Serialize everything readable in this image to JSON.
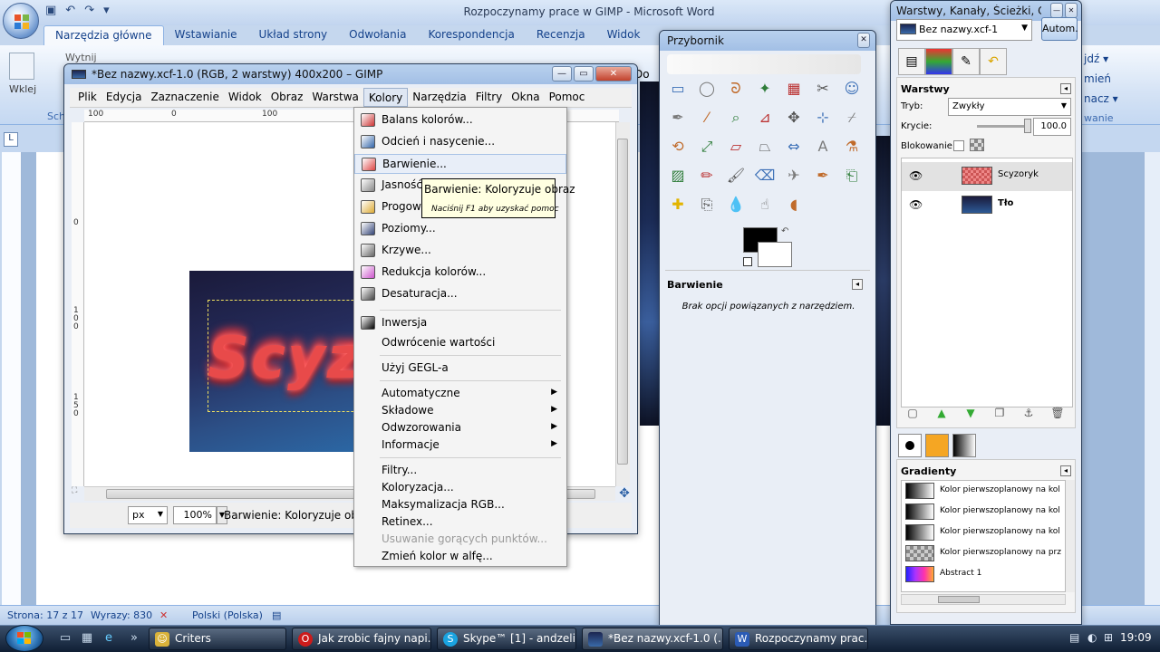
{
  "word": {
    "title": "Rozpoczynamy prace w GIMP - Microsoft Word",
    "tabs": [
      "Narzędzia główne",
      "Wstawianie",
      "Układ strony",
      "Odwołania",
      "Korespondencja",
      "Recenzja",
      "Widok",
      "Dewe"
    ],
    "paste": "Wklej",
    "cut": "Wytnij",
    "clipboard": "Sch",
    "right_ribbon": [
      "jdź ▾",
      "mień",
      "nacz ▾",
      "wanie"
    ],
    "ruler_left": "L",
    "doc_glimpse": "Do",
    "status": {
      "page": "Strona: 17 z 17",
      "words": "Wyrazy: 830",
      "lang": "Polski (Polska)"
    }
  },
  "gimp": {
    "title": "*Bez nazwy.xcf-1.0 (RGB, 2 warstwy) 400x200 – GIMP",
    "menus": [
      "Plik",
      "Edycja",
      "Zaznaczenie",
      "Widok",
      "Obraz",
      "Warstwa",
      "Kolory",
      "Narzędzia",
      "Filtry",
      "Okna",
      "Pomoc"
    ],
    "hruler": [
      "100",
      "0",
      "100"
    ],
    "vruler": [
      "0",
      "1\n0\n0",
      "1\n5\n0"
    ],
    "image_text": "Scyz",
    "unit": "px",
    "zoom": "100%",
    "status": "Barwienie: Koloryzuje obraz"
  },
  "colors_menu": {
    "items": [
      {
        "label": "Balans kolorów...",
        "icon": "balance-icon"
      },
      {
        "label": "Odcień i nasycenie...",
        "icon": "hue-icon"
      },
      {
        "label": "Barwienie...",
        "icon": "colorize-icon",
        "highlight": true
      },
      {
        "label": "Jasność i kontrast...",
        "icon": "brightness-icon"
      },
      {
        "label": "Progowanie...",
        "icon": "threshold-icon"
      },
      {
        "label": "Poziomy...",
        "icon": "levels-icon"
      },
      {
        "label": "Krzywe...",
        "icon": "curves-icon"
      },
      {
        "label": "Redukcja kolorów...",
        "icon": "posterize-icon"
      },
      {
        "label": "Desaturacja...",
        "icon": "desaturate-icon"
      },
      {
        "label": "Inwersja",
        "icon": "invert-icon"
      },
      {
        "label": "Odwrócenie wartości"
      },
      {
        "label": "Użyj GEGL-a"
      },
      {
        "label": "Automatyczne",
        "submenu": true
      },
      {
        "label": "Składowe",
        "submenu": true
      },
      {
        "label": "Odwzorowania",
        "submenu": true
      },
      {
        "label": "Informacje",
        "submenu": true
      },
      {
        "label": "Filtry..."
      },
      {
        "label": "Koloryzacja..."
      },
      {
        "label": "Maksymalizacja RGB..."
      },
      {
        "label": "Retinex..."
      },
      {
        "label": "Usuwanie gorących punktów...",
        "disabled": true
      },
      {
        "label": "Zmień kolor w alfę..."
      }
    ],
    "tooltip": {
      "title": "Barwienie: Koloryzuje obraz",
      "hint": "Naciśnij F1 aby uzyskać pomoc"
    }
  },
  "toolbox": {
    "title": "Przybornik",
    "options_title": "Barwienie",
    "options_text": "Brak opcji powiązanych z narzędziem.",
    "fg": "#000000",
    "bg": "#ffffff"
  },
  "dock": {
    "title": "Warstwy, Kanały, Ścieżki, Cofnięc...",
    "image": "Bez nazwy.xcf-1",
    "auto": "Autom.",
    "layers_title": "Warstwy",
    "mode_label": "Tryb:",
    "mode": "Zwykły",
    "opacity_label": "Krycie:",
    "opacity": "100.0",
    "lock_label": "Blokowanie:",
    "layers": [
      {
        "name": "Scyzoryk",
        "selected": true
      },
      {
        "name": "Tło",
        "selected": false
      }
    ],
    "gradients_title": "Gradienty",
    "gradients": [
      "Kolor pierwszoplanowy na kol",
      "Kolor pierwszoplanowy na kol",
      "Kolor pierwszoplanowy na kol",
      "Kolor pierwszoplanowy na prz",
      "Abstract 1"
    ]
  },
  "taskbar": {
    "buttons": [
      {
        "label": "Criters",
        "icon": "criters-icon"
      },
      {
        "label": "Jak zrobic fajny napi...",
        "icon": "opera-icon"
      },
      {
        "label": "Skype™ [1] - andzeli...",
        "icon": "skype-icon"
      },
      {
        "label": "*Bez nazwy.xcf-1.0 (...",
        "icon": "gimp-icon"
      },
      {
        "label": "Rozpoczynamy prac...",
        "icon": "word-icon"
      }
    ],
    "time": "19:09"
  }
}
